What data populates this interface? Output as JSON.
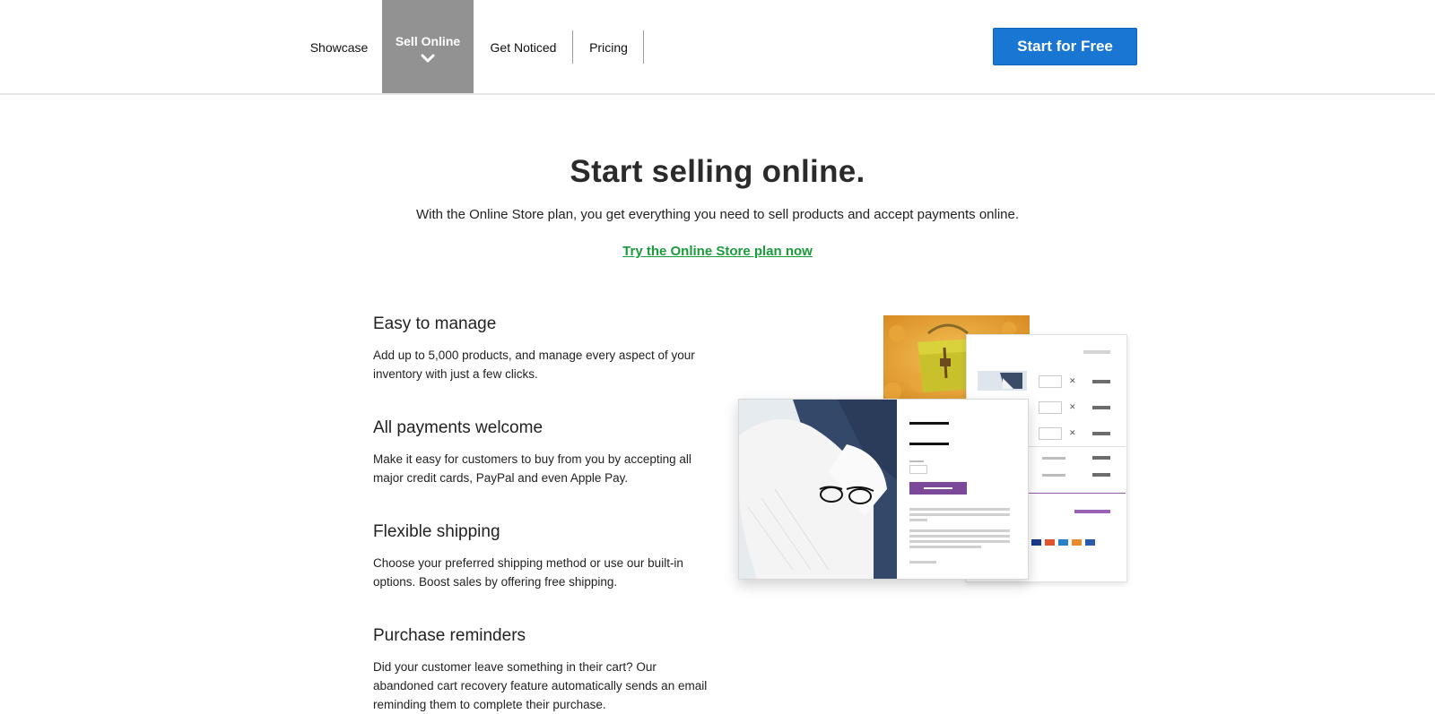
{
  "nav": {
    "items": [
      {
        "label": "Showcase"
      },
      {
        "label": "Sell Online"
      },
      {
        "label": "Get Noticed"
      },
      {
        "label": "Pricing"
      }
    ],
    "cta_label": "Start for Free"
  },
  "hero": {
    "title": "Start selling online.",
    "subtitle": "With the Online Store plan, you get everything you need to sell products and accept payments online.",
    "link": "Try the Online Store plan now"
  },
  "features": [
    {
      "title": "Easy to manage",
      "body": "Add up to 5,000 products, and manage every aspect of your inventory with just a few clicks."
    },
    {
      "title": "All payments welcome",
      "body": "Make it easy for customers to buy from you by accepting all major credit cards, PayPal and even Apple Pay."
    },
    {
      "title": "Flexible shipping",
      "body": "Choose your preferred shipping method or use our built-in options. Boost sales by offering free shipping."
    },
    {
      "title": "Purchase reminders",
      "body": "Did your customer leave something in their cart? Our abandoned cart recovery feature automatically sends an email reminding them to complete their purchase."
    }
  ],
  "colors": {
    "primary_blue": "#1976d2",
    "link_green": "#1a9c3a",
    "active_nav_gray": "#929292",
    "accent_purple": "#7a4a99"
  }
}
